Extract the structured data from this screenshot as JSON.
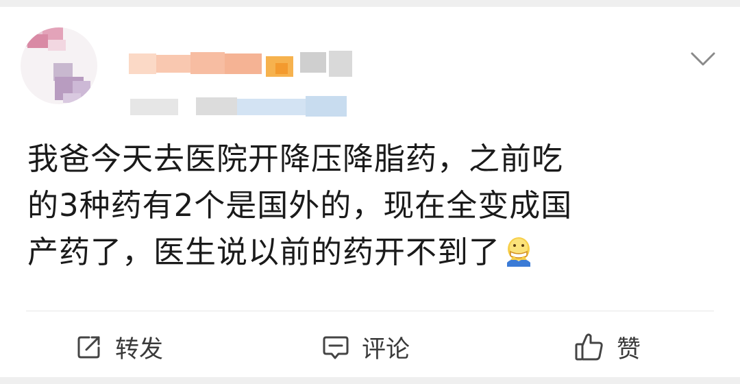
{
  "post": {
    "author_name": "",
    "text_line1": "我爸今天去医院开降压降脂药，之前吃",
    "text_line2": "的3种药有2个是国外的，现在全变成国",
    "text_line3": "产药了，医生说以前的药开不到了",
    "emoji_icon": "sweat-face-emoji",
    "menu_icon": "chevron-down-icon"
  },
  "actions": {
    "repost_label": "转发",
    "repost_icon": "share-icon",
    "comment_label": "评论",
    "comment_icon": "comment-icon",
    "like_label": "赞",
    "like_icon": "thumbs-up-icon"
  },
  "colors": {
    "text": "#1a1a1a",
    "action_text": "#3a3a3a",
    "icon": "#444444",
    "divider": "#e6e6e6",
    "background": "#efefef",
    "card": "#ffffff"
  }
}
